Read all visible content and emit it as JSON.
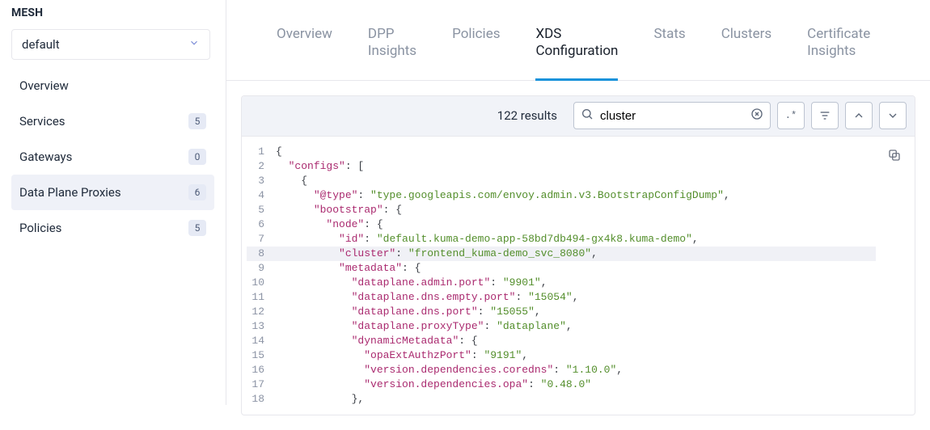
{
  "sidebar": {
    "title": "MESH",
    "select_value": "default",
    "items": [
      {
        "label": "Overview",
        "badge": null,
        "active": false
      },
      {
        "label": "Services",
        "badge": "5",
        "active": false
      },
      {
        "label": "Gateways",
        "badge": "0",
        "active": false
      },
      {
        "label": "Data Plane Proxies",
        "badge": "6",
        "active": true
      },
      {
        "label": "Policies",
        "badge": "5",
        "active": false
      }
    ]
  },
  "tabs": [
    {
      "label": "Overview",
      "active": false
    },
    {
      "label": "DPP\nInsights",
      "active": false
    },
    {
      "label": "Policies",
      "active": false
    },
    {
      "label": "XDS\nConfiguration",
      "active": true
    },
    {
      "label": "Stats",
      "active": false
    },
    {
      "label": "Clusters",
      "active": false
    },
    {
      "label": "Certificate\nInsights",
      "active": false
    }
  ],
  "panel": {
    "results_text": "122 results",
    "search_value": "cluster",
    "search_placeholder": "",
    "regex_btn_text": ".*"
  },
  "code": {
    "lines": [
      {
        "n": 1,
        "indent": 0,
        "hl": false,
        "tokens": [
          {
            "t": "pun",
            "v": "{"
          }
        ]
      },
      {
        "n": 2,
        "indent": 1,
        "hl": false,
        "tokens": [
          {
            "t": "key",
            "v": "\"configs\""
          },
          {
            "t": "pun",
            "v": ": ["
          }
        ]
      },
      {
        "n": 3,
        "indent": 2,
        "hl": false,
        "tokens": [
          {
            "t": "pun",
            "v": "{"
          }
        ]
      },
      {
        "n": 4,
        "indent": 3,
        "hl": false,
        "tokens": [
          {
            "t": "key",
            "v": "\"@type\""
          },
          {
            "t": "pun",
            "v": ": "
          },
          {
            "t": "str",
            "v": "\"type.googleapis.com/envoy.admin.v3.BootstrapConfigDump\""
          },
          {
            "t": "pun",
            "v": ","
          }
        ]
      },
      {
        "n": 5,
        "indent": 3,
        "hl": false,
        "tokens": [
          {
            "t": "key",
            "v": "\"bootstrap\""
          },
          {
            "t": "pun",
            "v": ": {"
          }
        ]
      },
      {
        "n": 6,
        "indent": 4,
        "hl": false,
        "tokens": [
          {
            "t": "key",
            "v": "\"node\""
          },
          {
            "t": "pun",
            "v": ": {"
          }
        ]
      },
      {
        "n": 7,
        "indent": 5,
        "hl": false,
        "tokens": [
          {
            "t": "key",
            "v": "\"id\""
          },
          {
            "t": "pun",
            "v": ": "
          },
          {
            "t": "str",
            "v": "\"default.kuma-demo-app-58bd7db494-gx4k8.kuma-demo\""
          },
          {
            "t": "pun",
            "v": ","
          }
        ]
      },
      {
        "n": 8,
        "indent": 5,
        "hl": true,
        "tokens": [
          {
            "t": "key",
            "v": "\"cluster\""
          },
          {
            "t": "pun",
            "v": ": "
          },
          {
            "t": "str",
            "v": "\"frontend_kuma-demo_svc_8080\""
          },
          {
            "t": "pun",
            "v": ","
          }
        ]
      },
      {
        "n": 9,
        "indent": 5,
        "hl": false,
        "tokens": [
          {
            "t": "key",
            "v": "\"metadata\""
          },
          {
            "t": "pun",
            "v": ": {"
          }
        ]
      },
      {
        "n": 10,
        "indent": 6,
        "hl": false,
        "tokens": [
          {
            "t": "key",
            "v": "\"dataplane.admin.port\""
          },
          {
            "t": "pun",
            "v": ": "
          },
          {
            "t": "str",
            "v": "\"9901\""
          },
          {
            "t": "pun",
            "v": ","
          }
        ]
      },
      {
        "n": 11,
        "indent": 6,
        "hl": false,
        "tokens": [
          {
            "t": "key",
            "v": "\"dataplane.dns.empty.port\""
          },
          {
            "t": "pun",
            "v": ": "
          },
          {
            "t": "str",
            "v": "\"15054\""
          },
          {
            "t": "pun",
            "v": ","
          }
        ]
      },
      {
        "n": 12,
        "indent": 6,
        "hl": false,
        "tokens": [
          {
            "t": "key",
            "v": "\"dataplane.dns.port\""
          },
          {
            "t": "pun",
            "v": ": "
          },
          {
            "t": "str",
            "v": "\"15055\""
          },
          {
            "t": "pun",
            "v": ","
          }
        ]
      },
      {
        "n": 13,
        "indent": 6,
        "hl": false,
        "tokens": [
          {
            "t": "key",
            "v": "\"dataplane.proxyType\""
          },
          {
            "t": "pun",
            "v": ": "
          },
          {
            "t": "str",
            "v": "\"dataplane\""
          },
          {
            "t": "pun",
            "v": ","
          }
        ]
      },
      {
        "n": 14,
        "indent": 6,
        "hl": false,
        "tokens": [
          {
            "t": "key",
            "v": "\"dynamicMetadata\""
          },
          {
            "t": "pun",
            "v": ": {"
          }
        ]
      },
      {
        "n": 15,
        "indent": 7,
        "hl": false,
        "tokens": [
          {
            "t": "key",
            "v": "\"opaExtAuthzPort\""
          },
          {
            "t": "pun",
            "v": ": "
          },
          {
            "t": "str",
            "v": "\"9191\""
          },
          {
            "t": "pun",
            "v": ","
          }
        ]
      },
      {
        "n": 16,
        "indent": 7,
        "hl": false,
        "tokens": [
          {
            "t": "key",
            "v": "\"version.dependencies.coredns\""
          },
          {
            "t": "pun",
            "v": ": "
          },
          {
            "t": "str",
            "v": "\"1.10.0\""
          },
          {
            "t": "pun",
            "v": ","
          }
        ]
      },
      {
        "n": 17,
        "indent": 7,
        "hl": false,
        "tokens": [
          {
            "t": "key",
            "v": "\"version.dependencies.opa\""
          },
          {
            "t": "pun",
            "v": ": "
          },
          {
            "t": "str",
            "v": "\"0.48.0\""
          }
        ]
      },
      {
        "n": 18,
        "indent": 6,
        "hl": false,
        "tokens": [
          {
            "t": "pun",
            "v": "},"
          }
        ]
      }
    ]
  }
}
